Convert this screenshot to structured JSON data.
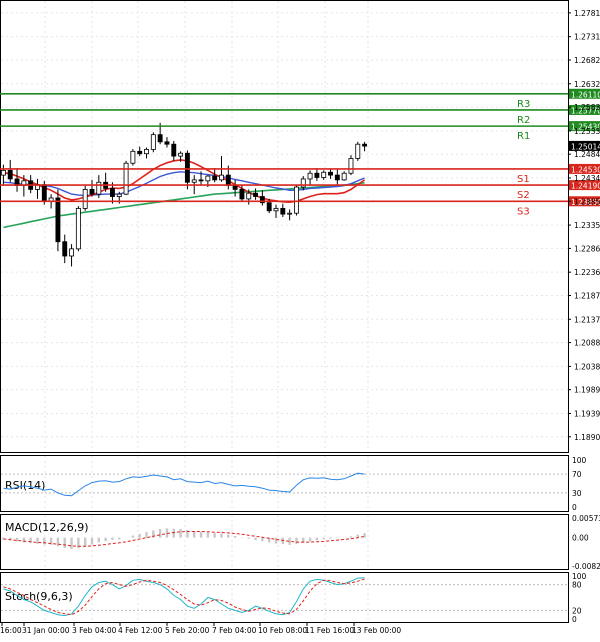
{
  "chart_data": {
    "type": "candlestick",
    "instrument_note": "",
    "main": {
      "ylim": [
        1.1858,
        1.2806
      ],
      "price_ticks": [
        "1.27810",
        "1.27310",
        "1.26820",
        "1.26320",
        "1.25830",
        "1.25330",
        "1.24840",
        "1.24340",
        "1.23850",
        "1.23350",
        "1.22860",
        "1.22360",
        "1.21870",
        "1.21370",
        "1.20880",
        "1.20380",
        "1.19890",
        "1.19390",
        "1.18900"
      ],
      "current_price": "1.25014",
      "levels": [
        {
          "name": "R3",
          "value": 1.2611,
          "label": "1.26110",
          "color": "#1f8a1f"
        },
        {
          "name": "R2",
          "value": 1.2577,
          "label": "1.25770",
          "color": "#1f8a1f"
        },
        {
          "name": "R1",
          "value": 1.2543,
          "label": "1.25430",
          "color": "#1f8a1f"
        },
        {
          "name": "S1",
          "value": 1.2453,
          "label": "1.24530",
          "color": "#d9261c"
        },
        {
          "name": "S2",
          "value": 1.2419,
          "label": "1.24190",
          "color": "#d9261c"
        },
        {
          "name": "S3",
          "value": 1.2385,
          "label": "1.23850",
          "color": "#d9261c"
        }
      ],
      "candles": [
        [
          1.244,
          1.2462,
          1.242,
          1.245
        ],
        [
          1.245,
          1.2472,
          1.2425,
          1.2432
        ],
        [
          1.2432,
          1.2455,
          1.2405,
          1.2418
        ],
        [
          1.2418,
          1.244,
          1.2395,
          1.2428
        ],
        [
          1.2428,
          1.244,
          1.2402,
          1.241
        ],
        [
          1.241,
          1.2432,
          1.239,
          1.242
        ],
        [
          1.242,
          1.2428,
          1.2378,
          1.2385
        ],
        [
          1.2385,
          1.24,
          1.237,
          1.2392
        ],
        [
          1.2392,
          1.241,
          1.228,
          1.23
        ],
        [
          1.23,
          1.2315,
          1.2255,
          1.227
        ],
        [
          1.227,
          1.2295,
          1.2248,
          1.2285
        ],
        [
          1.2285,
          1.2375,
          1.228,
          1.237
        ],
        [
          1.237,
          1.242,
          1.2365,
          1.241
        ],
        [
          1.241,
          1.243,
          1.2395,
          1.24
        ],
        [
          1.24,
          1.244,
          1.2392,
          1.2425
        ],
        [
          1.2425,
          1.2445,
          1.2405,
          1.2412
        ],
        [
          1.2412,
          1.2425,
          1.238,
          1.2395
        ],
        [
          1.2395,
          1.2405,
          1.238,
          1.24
        ],
        [
          1.24,
          1.247,
          1.2398,
          1.2465
        ],
        [
          1.2465,
          1.2495,
          1.246,
          1.249
        ],
        [
          1.249,
          1.25,
          1.248,
          1.2485
        ],
        [
          1.2485,
          1.2498,
          1.2475,
          1.2494
        ],
        [
          1.2494,
          1.253,
          1.2488,
          1.2525
        ],
        [
          1.2525,
          1.255,
          1.2505,
          1.251
        ],
        [
          1.251,
          1.252,
          1.2498,
          1.2505
        ],
        [
          1.2505,
          1.2512,
          1.247,
          1.248
        ],
        [
          1.248,
          1.249,
          1.2468,
          1.2486
        ],
        [
          1.2486,
          1.2492,
          1.241,
          1.2425
        ],
        [
          1.2425,
          1.244,
          1.24,
          1.243
        ],
        [
          1.243,
          1.2448,
          1.242,
          1.2428
        ],
        [
          1.2428,
          1.244,
          1.2415,
          1.2438
        ],
        [
          1.2438,
          1.2455,
          1.2425,
          1.243
        ],
        [
          1.243,
          1.248,
          1.2426,
          1.244
        ],
        [
          1.244,
          1.246,
          1.241,
          1.2418
        ],
        [
          1.2418,
          1.243,
          1.2395,
          1.241
        ],
        [
          1.241,
          1.242,
          1.2385,
          1.239
        ],
        [
          1.239,
          1.241,
          1.2378,
          1.2402
        ],
        [
          1.2402,
          1.2412,
          1.2388,
          1.2395
        ],
        [
          1.2395,
          1.2408,
          1.2376,
          1.2382
        ],
        [
          1.2382,
          1.239,
          1.236,
          1.2365
        ],
        [
          1.2365,
          1.2378,
          1.235,
          1.237
        ],
        [
          1.237,
          1.238,
          1.2352,
          1.2358
        ],
        [
          1.2358,
          1.2368,
          1.2345,
          1.236
        ],
        [
          1.236,
          1.242,
          1.2355,
          1.2415
        ],
        [
          1.2415,
          1.2438,
          1.2408,
          1.2432
        ],
        [
          1.2432,
          1.245,
          1.242,
          1.2444
        ],
        [
          1.2444,
          1.2455,
          1.2428,
          1.2435
        ],
        [
          1.2435,
          1.245,
          1.243,
          1.2446
        ],
        [
          1.2446,
          1.2452,
          1.2432,
          1.244
        ],
        [
          1.244,
          1.2452,
          1.242,
          1.243
        ],
        [
          1.243,
          1.2448,
          1.2428,
          1.2444
        ],
        [
          1.2444,
          1.2482,
          1.244,
          1.2475
        ],
        [
          1.2475,
          1.251,
          1.247,
          1.2505
        ],
        [
          1.2505,
          1.251,
          1.249,
          1.2501
        ]
      ],
      "ma_blue": [
        1.2425,
        1.2424,
        1.2422,
        1.2421,
        1.242,
        1.2419,
        1.2418,
        1.2416,
        1.2412,
        1.2406,
        1.24,
        1.2398,
        1.2397,
        1.2398,
        1.2399,
        1.24,
        1.24,
        1.24,
        1.2404,
        1.241,
        1.2416,
        1.2423,
        1.243,
        1.2437,
        1.2442,
        1.2445,
        1.2447,
        1.2446,
        1.2445,
        1.2443,
        1.2441,
        1.2439,
        1.2437,
        1.2434,
        1.2431,
        1.2428,
        1.2425,
        1.2422,
        1.2419,
        1.2416,
        1.2413,
        1.2411,
        1.2408,
        1.2408,
        1.241,
        1.2412,
        1.2413,
        1.2414,
        1.2415,
        1.2416,
        1.2418,
        1.2422,
        1.2428,
        1.2434
      ],
      "ma_red": [
        1.2445,
        1.2443,
        1.2438,
        1.2432,
        1.2426,
        1.242,
        1.2414,
        1.2408,
        1.24,
        1.2392,
        1.2388,
        1.239,
        1.2394,
        1.2398,
        1.2404,
        1.241,
        1.2413,
        1.2412,
        1.2415,
        1.2422,
        1.2432,
        1.2442,
        1.2452,
        1.246,
        1.2466,
        1.247,
        1.2472,
        1.247,
        1.2465,
        1.2458,
        1.245,
        1.2442,
        1.2435,
        1.2428,
        1.242,
        1.2412,
        1.2404,
        1.2397,
        1.2392,
        1.2388,
        1.2386,
        1.2384,
        1.2383,
        1.2385,
        1.239,
        1.2395,
        1.2399,
        1.2401,
        1.2401,
        1.2401,
        1.2403,
        1.241,
        1.242,
        1.243
      ],
      "ma_green": [
        1.233,
        1.2333,
        1.2336,
        1.2339,
        1.2342,
        1.2345,
        1.2348,
        1.2351,
        1.2354,
        1.2356,
        1.2358,
        1.236,
        1.2362,
        1.2364,
        1.2366,
        1.2368,
        1.237,
        1.2372,
        1.2374,
        1.2376,
        1.2378,
        1.238,
        1.2382,
        1.2384,
        1.2386,
        1.2388,
        1.239,
        1.2392,
        1.2394,
        1.2396,
        1.2398,
        1.24,
        1.2401,
        1.2402,
        1.2403,
        1.2404,
        1.2405,
        1.2406,
        1.2407,
        1.2408,
        1.2409,
        1.241,
        1.2411,
        1.2412,
        1.2413,
        1.2414,
        1.2415,
        1.2416,
        1.2417,
        1.2418,
        1.2419,
        1.242,
        1.2422,
        1.2424
      ]
    },
    "rsi": {
      "label": "RSI(14)",
      "levels": [
        "100",
        "70",
        "30",
        "0"
      ],
      "ylim": [
        0,
        100
      ],
      "values": [
        40,
        38,
        42,
        45,
        43,
        40,
        36,
        38,
        30,
        25,
        24,
        35,
        45,
        52,
        55,
        56,
        53,
        54,
        60,
        64,
        63,
        65,
        68,
        66,
        64,
        58,
        60,
        54,
        53,
        52,
        55,
        50,
        52,
        48,
        45,
        46,
        44,
        43,
        40,
        36,
        35,
        33,
        32,
        46,
        58,
        62,
        61,
        62,
        59,
        58,
        60,
        66,
        72,
        70
      ]
    },
    "macd": {
      "label": "MACD(12,26,9)",
      "ticks": [
        "0.005731",
        "0.00",
        "-0.00826"
      ],
      "ylim": [
        -0.00826,
        0.005731
      ],
      "histogram": [
        -0.0005,
        -0.0008,
        -0.0011,
        -0.0014,
        -0.0016,
        -0.0018,
        -0.002,
        -0.0021,
        -0.0025,
        -0.003,
        -0.0033,
        -0.0031,
        -0.0026,
        -0.002,
        -0.0014,
        -0.001,
        -0.0007,
        -0.0005,
        0.0,
        0.0006,
        0.0011,
        0.0016,
        0.0021,
        0.0025,
        0.0027,
        0.0026,
        0.0025,
        0.0022,
        0.0019,
        0.0017,
        0.0015,
        0.0013,
        0.0012,
        0.0009,
        0.0005,
        0.0001,
        -0.0003,
        -0.0007,
        -0.001,
        -0.0014,
        -0.0017,
        -0.0019,
        -0.0021,
        -0.0019,
        -0.0015,
        -0.0011,
        -0.0008,
        -0.0005,
        -0.0003,
        -0.0001,
        0.0,
        0.0004,
        0.0009,
        0.0013
      ],
      "signal": [
        -0.0004,
        -0.0006,
        -0.0008,
        -0.001,
        -0.0012,
        -0.0014,
        -0.0015,
        -0.0017,
        -0.0019,
        -0.0021,
        -0.0024,
        -0.0025,
        -0.0025,
        -0.0024,
        -0.0022,
        -0.002,
        -0.0017,
        -0.0015,
        -0.0012,
        -0.0008,
        -0.0004,
        0.0,
        0.0004,
        0.0008,
        0.0012,
        0.0015,
        0.0017,
        0.0018,
        0.0018,
        0.0018,
        0.0017,
        0.0016,
        0.0015,
        0.0014,
        0.0012,
        0.001,
        0.0007,
        0.0004,
        0.0001,
        -0.0002,
        -0.0005,
        -0.0008,
        -0.0011,
        -0.0013,
        -0.0013,
        -0.0013,
        -0.0012,
        -0.0011,
        -0.0009,
        -0.0007,
        -0.0005,
        -0.0003,
        0.0,
        0.0004
      ]
    },
    "stoch": {
      "label": "Stoch(9,6,3)",
      "levels": [
        "100",
        "80",
        "20",
        "0"
      ],
      "ylim": [
        0,
        100
      ],
      "main": [
        70,
        65,
        55,
        45,
        40,
        30,
        20,
        15,
        10,
        8,
        12,
        30,
        55,
        75,
        85,
        88,
        80,
        70,
        78,
        90,
        92,
        88,
        85,
        80,
        70,
        55,
        45,
        30,
        25,
        35,
        50,
        45,
        35,
        25,
        20,
        15,
        20,
        30,
        25,
        18,
        12,
        10,
        15,
        40,
        70,
        88,
        92,
        90,
        85,
        80,
        82,
        88,
        95,
        96
      ],
      "signal": [
        75,
        70,
        62,
        55,
        45,
        38,
        30,
        22,
        15,
        12,
        10,
        18,
        32,
        52,
        70,
        82,
        85,
        80,
        76,
        80,
        86,
        90,
        88,
        85,
        78,
        68,
        57,
        45,
        35,
        32,
        38,
        45,
        43,
        37,
        28,
        22,
        18,
        22,
        26,
        24,
        18,
        14,
        12,
        22,
        42,
        65,
        82,
        90,
        89,
        85,
        82,
        84,
        88,
        93
      ]
    },
    "x_labels": [
      "16:00",
      "31 Jan 00:00",
      "3 Feb 04:00",
      "4 Feb 12:00",
      "5 Feb 20:00",
      "7 Feb 04:00",
      "10 Feb 08:00",
      "11 Feb 16:00",
      "13 Feb 00:00"
    ],
    "colors": {
      "bull_body": "#ffffff",
      "bear_body": "#000000",
      "ma_blue": "#3d56d6",
      "ma_red": "#e0211a",
      "ma_green": "#27a35a",
      "rsi_line": "#2a86e6",
      "macd_hist": "#c8c8c8",
      "macd_signal": "#e0211a",
      "stoch_main": "#21b7c9",
      "stoch_signal": "#e0211a",
      "grid": "#e6e6e6",
      "current_price_bg": "#000000"
    }
  }
}
